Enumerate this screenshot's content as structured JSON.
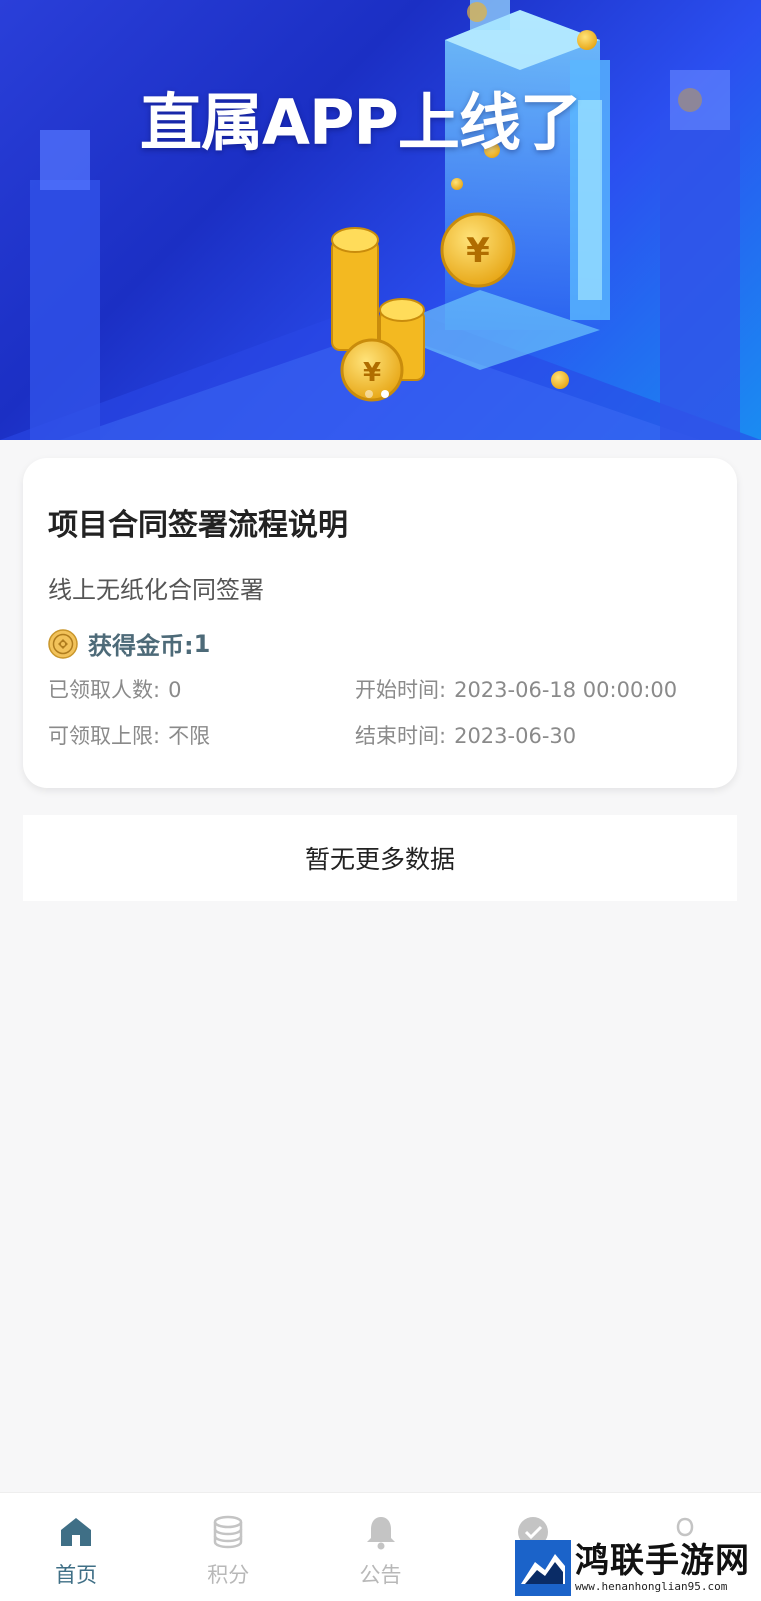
{
  "banner": {
    "title": "直属APP上线了",
    "slide_count": 2,
    "active_slide": 1
  },
  "task_card": {
    "title": "项目合同签署流程说明",
    "description": "线上无纸化合同签署",
    "reward_label": "获得金币:",
    "reward_value": "1",
    "claimed_label": "已领取人数:",
    "claimed_value": "0",
    "limit_label": "可领取上限:",
    "limit_value": "不限",
    "start_label": "开始时间:",
    "start_value": "2023-06-18 00:00:00",
    "end_label": "结束时间:",
    "end_value": "2023-06-30"
  },
  "list_footer": {
    "text": "暂无更多数据"
  },
  "tabbar": {
    "tabs": [
      {
        "label": "首页",
        "icon": "home-icon",
        "active": true
      },
      {
        "label": "积分",
        "icon": "coin-stack-icon",
        "active": false
      },
      {
        "label": "公告",
        "icon": "bell-icon",
        "active": false
      },
      {
        "label": "",
        "icon": "check-circle-icon",
        "active": false
      },
      {
        "label": "",
        "icon": "user-icon",
        "active": false
      }
    ]
  },
  "watermark": {
    "title": "鸿联手游网",
    "url": "www.henanhonglian95.com"
  },
  "colors": {
    "accent": "#3f6f86",
    "reward_text": "#4d6a78",
    "inactive_tab": "#b8b8b8",
    "banner_blue": "#1b2fc4"
  }
}
